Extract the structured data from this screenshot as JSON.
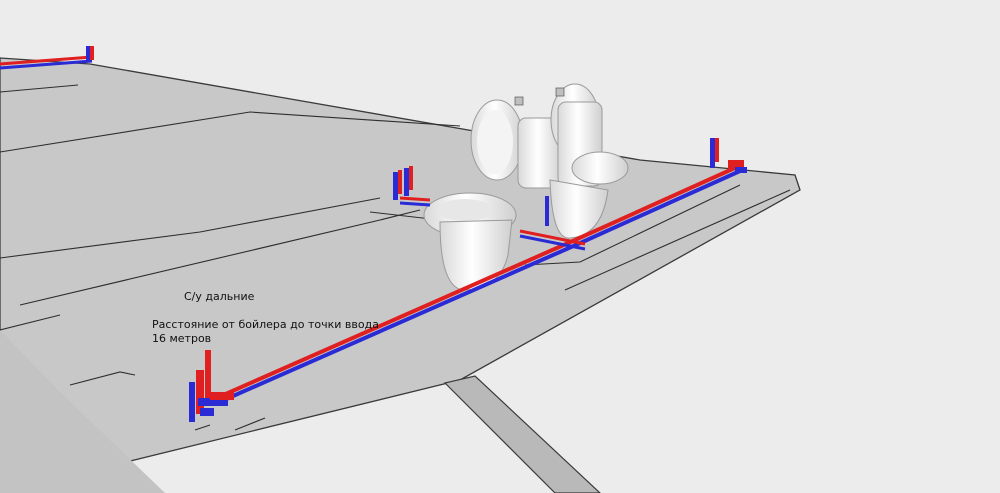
{
  "annotations": {
    "title": "С/у дальние",
    "distance_line1": "Расстояние от бойлера до точки ввода",
    "distance_line2": "16 метров"
  },
  "colors": {
    "background": "#ececec",
    "floor": "#c9c9c9",
    "floor_edge": "#3a3a3a",
    "hot_pipe": "#e02020",
    "cold_pipe": "#2b2bd6",
    "fixture": "#ffffff"
  }
}
